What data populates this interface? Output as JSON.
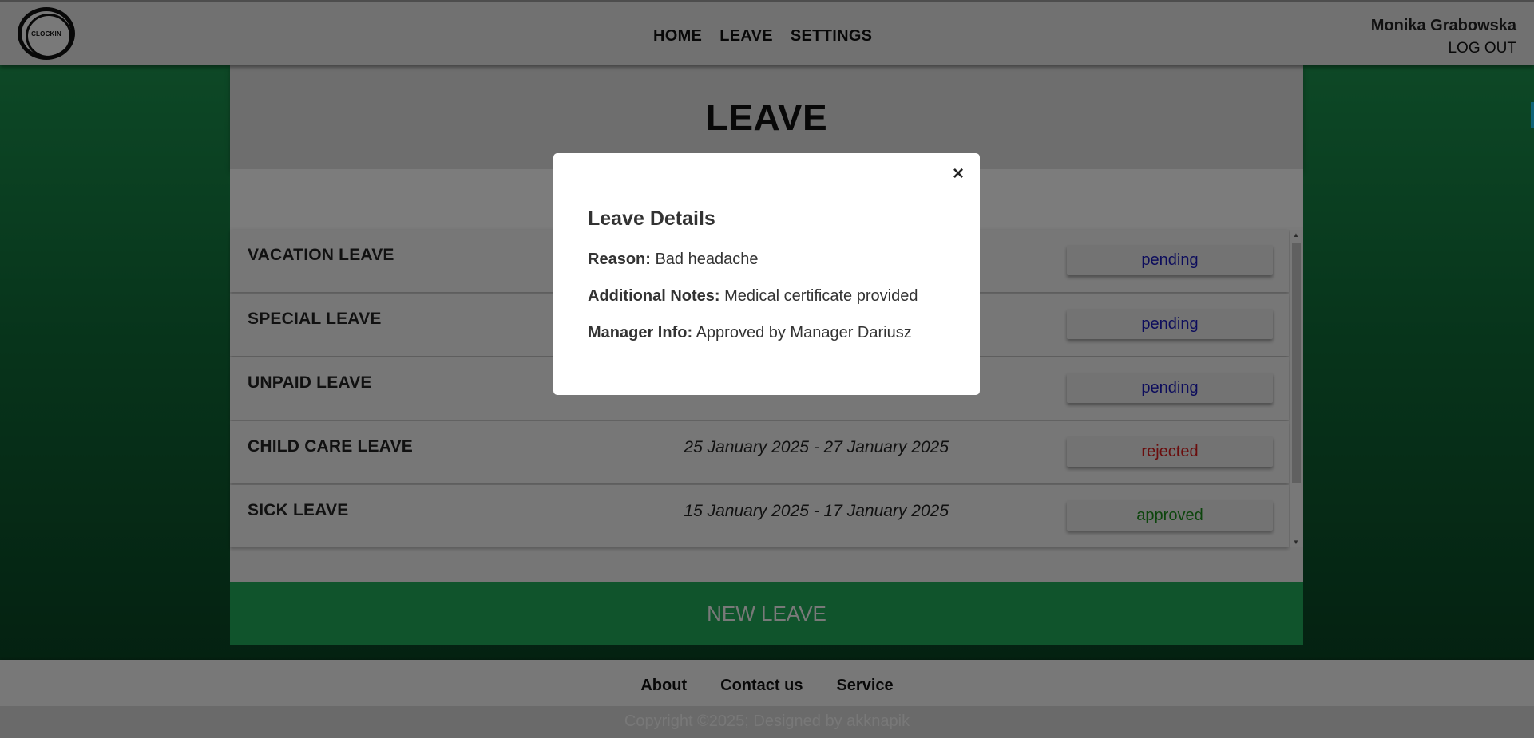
{
  "header": {
    "logo_text": "CLOCKIN",
    "nav": [
      "HOME",
      "LEAVE",
      "SETTINGS"
    ],
    "user_name": "Monika Grabowska",
    "logout_label": "LOG OUT"
  },
  "page": {
    "title": "LEAVE",
    "new_leave_label": "NEW LEAVE"
  },
  "leaves": [
    {
      "type": "VACATION LEAVE",
      "dates": "",
      "status": "pending",
      "status_color": "#1818b8"
    },
    {
      "type": "SPECIAL LEAVE",
      "dates": "",
      "status": "pending",
      "status_color": "#1818b8"
    },
    {
      "type": "UNPAID LEAVE",
      "dates": "",
      "status": "pending",
      "status_color": "#1818b8"
    },
    {
      "type": "CHILD CARE LEAVE",
      "dates": "25 January 2025 - 27 January 2025",
      "status": "rejected",
      "status_color": "#d41a1a"
    },
    {
      "type": "SICK LEAVE",
      "dates": "15 January 2025 - 17 January 2025",
      "status": "approved",
      "status_color": "#1a8a1a"
    }
  ],
  "modal": {
    "close_glyph": "×",
    "title": "Leave Details",
    "reason_label": "Reason:",
    "reason_value": "Bad headache",
    "notes_label": "Additional Notes:",
    "notes_value": "Medical certificate provided",
    "manager_label": "Manager Info:",
    "manager_value": "Approved by Manager Dariusz"
  },
  "footer": {
    "links": [
      "About",
      "Contact us",
      "Service"
    ],
    "copyright": "Copyright ©2025; Designed by akknapik"
  },
  "colors": {
    "accent_green": "#21a858",
    "overlay": "rgba(0,0,0,0.5)"
  }
}
